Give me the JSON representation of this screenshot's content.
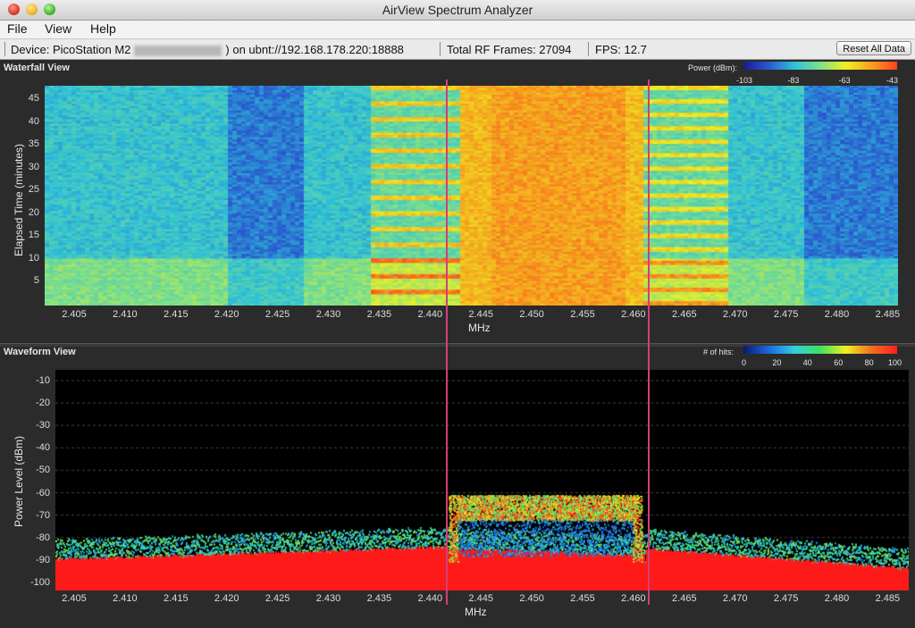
{
  "window": {
    "title": "AirView Spectrum Analyzer"
  },
  "menu": {
    "file": "File",
    "view": "View",
    "help": "Help"
  },
  "status": {
    "device_prefix": "Device: PicoStation M2",
    "device_suffix": ") on ubnt://192.168.178.220:18888",
    "frames": "Total RF Frames: 27094",
    "fps": "FPS: 12.7",
    "reset_button": "Reset All Data"
  },
  "waterfall": {
    "title": "Waterfall View",
    "legend_label": "Power (dBm):",
    "legend_ticks": [
      "-103",
      "-83",
      "-63",
      "-43"
    ],
    "y_title": "Elapsed Time (minutes)",
    "y_ticks": [
      "45",
      "40",
      "35",
      "30",
      "25",
      "20",
      "15",
      "10",
      "5"
    ],
    "x_ticks": [
      "2.405",
      "2.410",
      "2.415",
      "2.420",
      "2.425",
      "2.430",
      "2.435",
      "2.440",
      "2.445",
      "2.450",
      "2.455",
      "2.460",
      "2.465",
      "2.470",
      "2.475",
      "2.480",
      "2.485"
    ],
    "x_title": "MHz"
  },
  "waveform": {
    "title": "Waveform View",
    "legend_label": "# of hits:",
    "legend_ticks": [
      "0",
      "20",
      "40",
      "60",
      "80",
      "100"
    ],
    "y_title": "Power Level (dBm)",
    "y_ticks": [
      "-10",
      "-20",
      "-30",
      "-40",
      "-50",
      "-60",
      "-70",
      "-80",
      "-90",
      "-100"
    ],
    "x_ticks": [
      "2.405",
      "2.410",
      "2.415",
      "2.420",
      "2.425",
      "2.430",
      "2.435",
      "2.440",
      "2.445",
      "2.450",
      "2.455",
      "2.460",
      "2.465",
      "2.470",
      "2.475",
      "2.480",
      "2.485"
    ],
    "x_title": "MHz"
  },
  "colors": {
    "marker": "#d0407a",
    "gradient_power": [
      "#1a1a8c",
      "#2a5ad0",
      "#2fc2d8",
      "#7fe08a",
      "#f0f020",
      "#f6a020",
      "#ff4020"
    ],
    "gradient_hits": [
      "#0a1a6a",
      "#1a6ae0",
      "#30d0e0",
      "#40e060",
      "#f0f020",
      "#f07020",
      "#ff2020"
    ]
  }
}
